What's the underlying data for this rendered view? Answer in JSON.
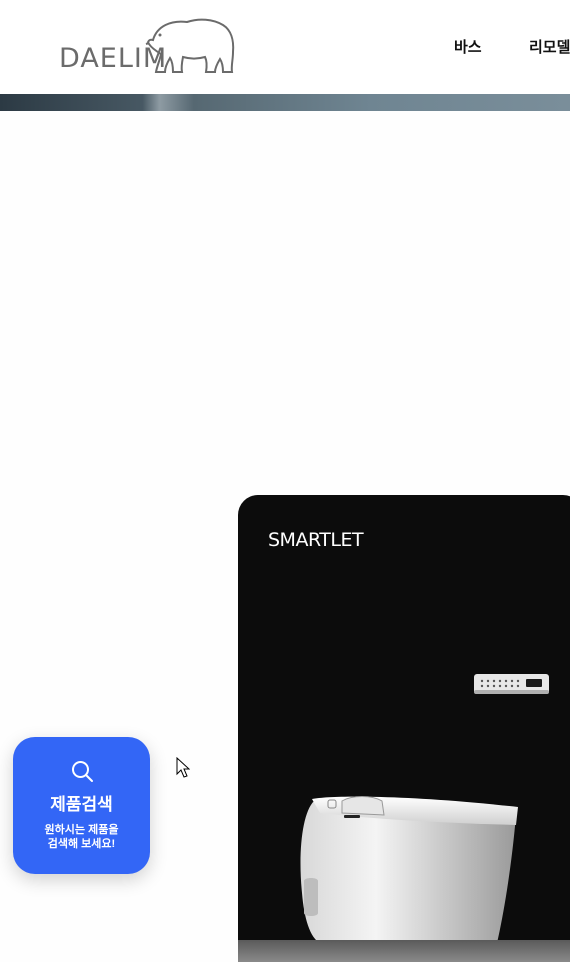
{
  "header": {
    "logo_text": "DAELIM",
    "nav": [
      {
        "label": "바스"
      },
      {
        "label": "리모델"
      }
    ]
  },
  "product_card": {
    "title": "SMARTLET",
    "image": "smart-toilet-photo"
  },
  "search_widget": {
    "icon": "search-icon",
    "title": "제품검색",
    "description_line1": "원하시는 제품을",
    "description_line2": "검색해 보세요!",
    "background_color": "#3366f6"
  },
  "colors": {
    "card_background": "#0c0c0c",
    "logo_gray": "#6b6b6b"
  }
}
